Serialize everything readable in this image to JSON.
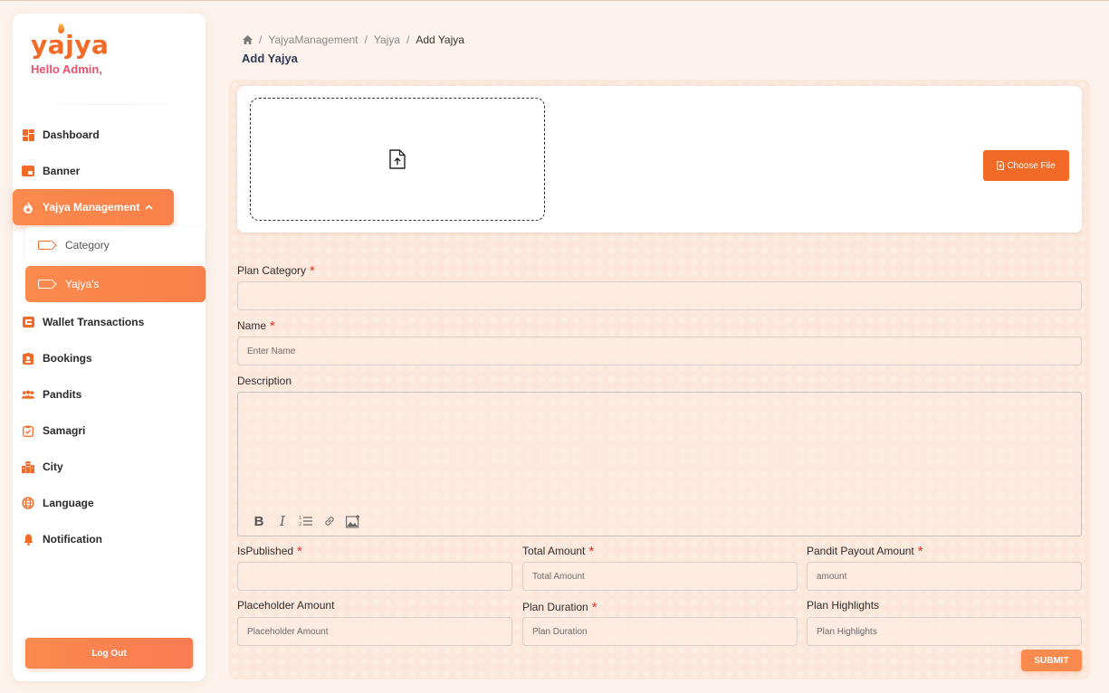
{
  "brand": {
    "logo_text": "yajya",
    "greeting": "Hello Admin,"
  },
  "sidebar": {
    "items": [
      {
        "label": "Dashboard",
        "icon": "dashboard-grid-icon"
      },
      {
        "label": "Banner",
        "icon": "banner-icon"
      },
      {
        "label": "Yajya Management",
        "icon": "flame-icon",
        "expanded": true
      },
      {
        "label": "Wallet Transactions",
        "icon": "wallet-icon"
      },
      {
        "label": "Bookings",
        "icon": "bookings-icon"
      },
      {
        "label": "Pandits",
        "icon": "people-icon"
      },
      {
        "label": "Samagri",
        "icon": "clipboard-icon"
      },
      {
        "label": "City",
        "icon": "city-icon"
      },
      {
        "label": "Language",
        "icon": "globe-icon"
      },
      {
        "label": "Notification",
        "icon": "bell-icon"
      }
    ],
    "sub_items": [
      {
        "label": "Category"
      },
      {
        "label": "Yajya's"
      }
    ],
    "logout_label": "Log Out"
  },
  "breadcrumb": {
    "items": [
      "YajyaManagement",
      "Yajya",
      "Add Yajya"
    ],
    "separator": "/"
  },
  "page": {
    "title": "Add Yajya"
  },
  "upload": {
    "choose_label": "Choose File"
  },
  "form": {
    "plan_category": {
      "label": "Plan Category",
      "value": "",
      "placeholder": ""
    },
    "name": {
      "label": "Name",
      "placeholder": "Enter Name"
    },
    "description": {
      "label": "Description"
    },
    "is_published": {
      "label": "IsPublished",
      "placeholder": ""
    },
    "total_amount": {
      "label": "Total Amount",
      "placeholder": "Total Amount"
    },
    "pandit_payout": {
      "label": "Pandit Payout Amount",
      "placeholder": "amount"
    },
    "placeholder_amount": {
      "label": "Placeholder Amount",
      "placeholder": "Placeholder Amount"
    },
    "plan_duration": {
      "label": "Plan Duration",
      "placeholder": "Plan Duration"
    },
    "plan_highlights": {
      "label": "Plan Highlights",
      "placeholder": "Plan Highlights"
    },
    "required_mark": "*",
    "submit_label": "SUBMIT"
  },
  "colors": {
    "accent": "#f26a25",
    "accent_light": "#fb8a4e",
    "greeting": "#f0516b",
    "required": "#e4312b"
  }
}
